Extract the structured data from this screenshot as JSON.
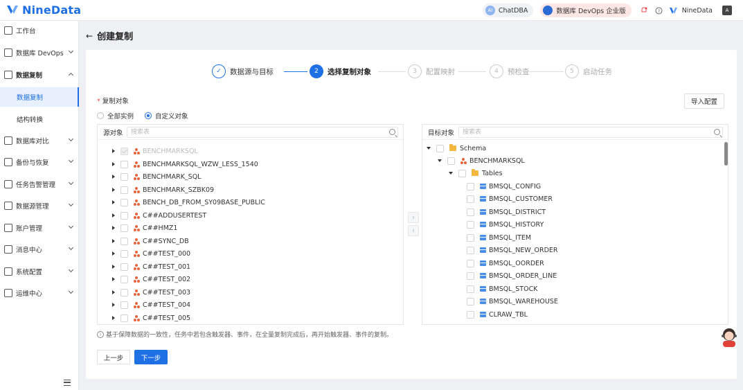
{
  "app": {
    "brand": "NineData"
  },
  "topbar": {
    "chat_label": "ChatDBA",
    "chat_icon_text": "AI",
    "edition_label": "数据库 DevOps 企业版",
    "user_name": "NineData",
    "lang_icon_text": "A"
  },
  "sidebar": {
    "items": [
      {
        "label": "工作台"
      },
      {
        "label": "数据库 DevOps"
      },
      {
        "label": "数据复制"
      },
      {
        "label": "数据库对比"
      },
      {
        "label": "备份与恢复"
      },
      {
        "label": "任务告警管理"
      },
      {
        "label": "数据源管理"
      },
      {
        "label": "账户管理"
      },
      {
        "label": "消息中心"
      },
      {
        "label": "系统配置"
      },
      {
        "label": "运维中心"
      }
    ],
    "subitems": [
      {
        "label": "数据复制"
      },
      {
        "label": "结构转换"
      }
    ]
  },
  "page": {
    "title": "创建复制",
    "back": "←"
  },
  "steps": [
    {
      "num": "✓",
      "label": "数据源与目标",
      "state": "done"
    },
    {
      "num": "2",
      "label": "选择复制对象",
      "state": "active"
    },
    {
      "num": "3",
      "label": "配置映射",
      "state": "todo"
    },
    {
      "num": "4",
      "label": "预检查",
      "state": "todo"
    },
    {
      "num": "5",
      "label": "启动任务",
      "state": "todo"
    }
  ],
  "form": {
    "required_mark": "*",
    "label": "复制对象",
    "option_all": "全部实例",
    "option_custom": "自定义对象",
    "selected": "自定义对象",
    "import_button": "导入配置"
  },
  "source": {
    "label": "源对象",
    "search_placeholder": "搜索表",
    "rows": [
      "BENCHMARKSQL",
      "BENCHMARKSQL_WZW_LESS_1540",
      "BENCHMARK_SQL",
      "BENCHMARK_SZBK09",
      "BENCH_DB_FROM_SY09BASE_PUBLIC",
      "C##ADDUSERTEST",
      "C##HMZ1",
      "C##SYNC_DB",
      "C##TEST_000",
      "C##TEST_001",
      "C##TEST_002",
      "C##TEST_003",
      "C##TEST_004",
      "C##TEST_005"
    ]
  },
  "target": {
    "label": "目标对象",
    "search_placeholder": "搜索表",
    "schema_label": "Schema",
    "db_label": "BENCHMARKSQL",
    "tables_label": "Tables",
    "tables": [
      "BMSQL_CONFIG",
      "BMSQL_CUSTOMER",
      "BMSQL_DISTRICT",
      "BMSQL_HISTORY",
      "BMSQL_ITEM",
      "BMSQL_NEW_ORDER",
      "BMSQL_OORDER",
      "BMSQL_ORDER_LINE",
      "BMSQL_STOCK",
      "BMSQL_WAREHOUSE",
      "CLRAW_TBL"
    ]
  },
  "transfer": {
    "right": "›",
    "left": "‹"
  },
  "note": {
    "icon": "i",
    "text": "基于保障数据的一致性，任务中若包含触发器、事件，在全量复制完成后，再开始触发器、事件的复制。"
  },
  "buttons": {
    "prev": "上一步",
    "next": "下一步"
  },
  "colors": {
    "accent": "#1f6fe5",
    "db_icon": "#e6643c",
    "folder": "#f5b942"
  }
}
